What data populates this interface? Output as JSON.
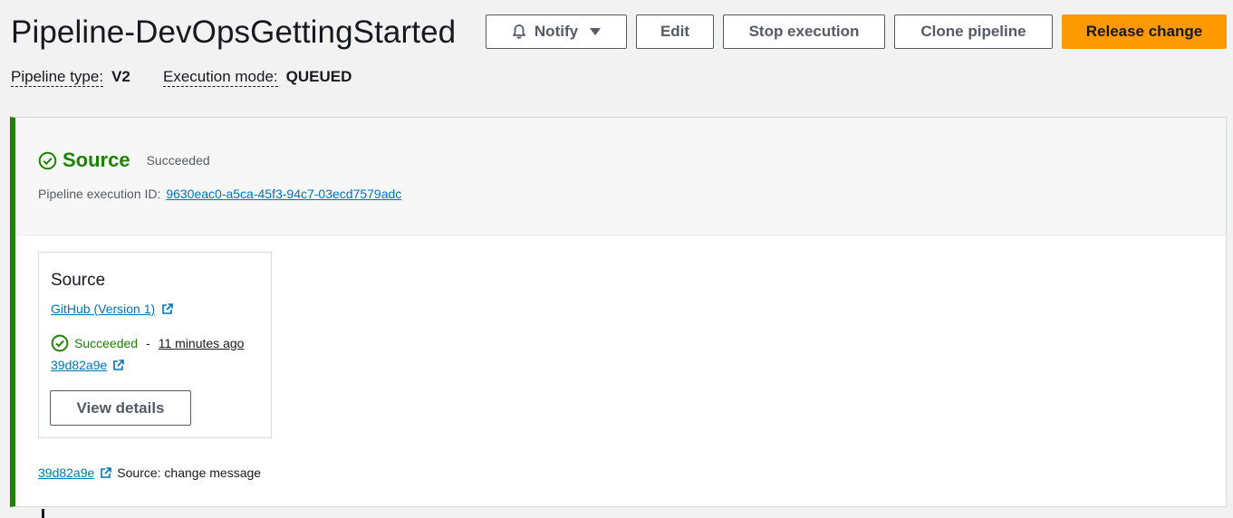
{
  "page": {
    "title": "Pipeline-DevOpsGettingStarted"
  },
  "toolbar": {
    "notify_label": "Notify",
    "edit_label": "Edit",
    "stop_label": "Stop execution",
    "clone_label": "Clone pipeline",
    "release_label": "Release change"
  },
  "meta": {
    "pipeline_type_label": "Pipeline type:",
    "pipeline_type_value": "V2",
    "execution_mode_label": "Execution mode:",
    "execution_mode_value": "QUEUED"
  },
  "stage": {
    "name": "Source",
    "status": "Succeeded",
    "execution_id_label": "Pipeline execution ID:",
    "execution_id": "9630eac0-a5ca-45f3-94c7-03ecd7579adc",
    "action": {
      "title": "Source",
      "provider": "GitHub (Version 1)",
      "status": "Succeeded",
      "separator": "-",
      "time": "11 minutes ago",
      "commit": "39d82a9e",
      "details_label": "View details"
    },
    "footer": {
      "commit": "39d82a9e",
      "message": "Source: change message"
    }
  },
  "colors": {
    "success": "#1d8102",
    "link": "#0073bb",
    "primary": "#ff9900"
  },
  "icons": [
    "bell-icon",
    "caret-down-icon",
    "check-circle-icon",
    "external-link-icon"
  ]
}
